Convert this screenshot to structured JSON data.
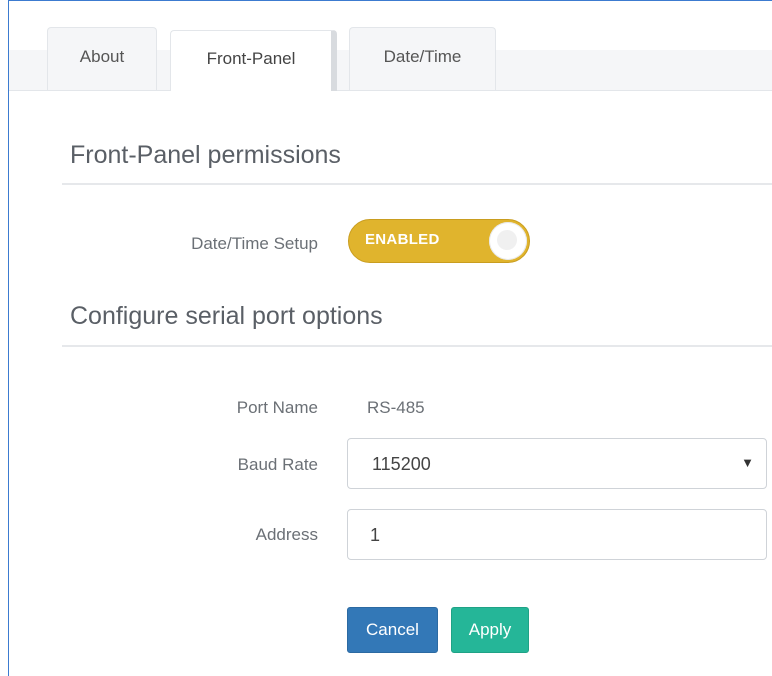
{
  "tabs": [
    {
      "label": "About",
      "active": false
    },
    {
      "label": "Front-Panel",
      "active": true
    },
    {
      "label": "Date/Time",
      "active": false
    }
  ],
  "front_panel": {
    "section_title": "Front-Panel permissions",
    "datetime_setup": {
      "label": "Date/Time Setup",
      "toggle_text": "ENABLED",
      "enabled": true
    }
  },
  "serial": {
    "section_title": "Configure serial port options",
    "port_name_label": "Port Name",
    "port_name_value": "RS-485",
    "baud_rate_label": "Baud Rate",
    "baud_rate_value": "115200",
    "address_label": "Address",
    "address_value": "1"
  },
  "actions": {
    "cancel_label": "Cancel",
    "apply_label": "Apply"
  },
  "colors": {
    "toggle_on": "#e0b42d",
    "cancel_button": "#3378b7",
    "apply_button": "#25b698",
    "frame_border": "#3c7bd0"
  },
  "icons": {
    "select_caret": "caret-down-icon"
  }
}
